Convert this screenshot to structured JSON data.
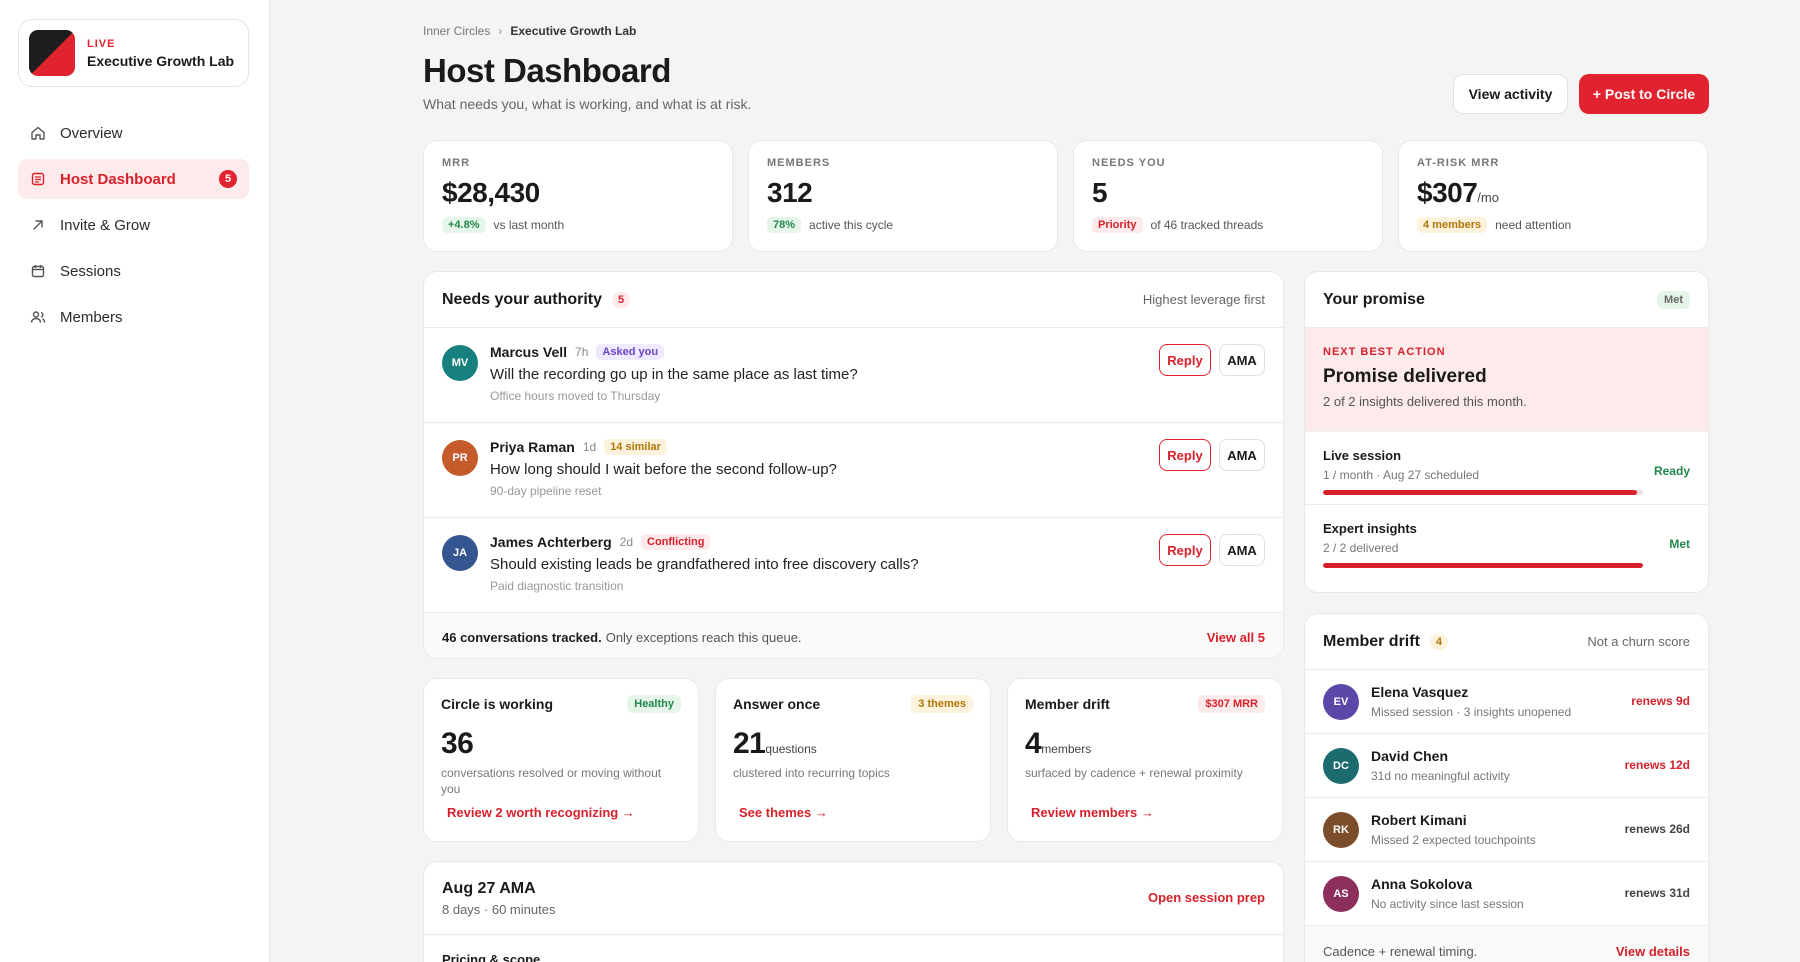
{
  "brand": {
    "status": "LIVE",
    "name": "Executive Growth Lab"
  },
  "nav": {
    "items": [
      {
        "label": "Overview",
        "icon": "home-icon"
      },
      {
        "label": "Host Dashboard",
        "icon": "dashboard-icon",
        "badge": "5"
      },
      {
        "label": "Invite & Grow",
        "icon": "arrow-up-right-icon"
      },
      {
        "label": "Sessions",
        "icon": "calendar-icon"
      },
      {
        "label": "Members",
        "icon": "users-icon"
      }
    ]
  },
  "breadcrumb": {
    "parent": "Inner Circles",
    "separator": "›",
    "current": "Executive Growth Lab"
  },
  "header": {
    "title": "Host Dashboard",
    "subtitle": "What needs you, what is working, and what is at risk.",
    "view_activity": "View activity",
    "post": "+ Post to Circle"
  },
  "kpis": [
    {
      "label": "MRR",
      "value": "$28,430",
      "unit": "",
      "pill": "+4.8%",
      "note": "vs last month"
    },
    {
      "label": "MEMBERS",
      "value": "312",
      "unit": "",
      "pill": "78%",
      "note": "active this cycle"
    },
    {
      "label": "NEEDS YOU",
      "value": "5",
      "unit": "",
      "pill": "Priority",
      "note": "of 46 tracked threads"
    },
    {
      "label": "AT-RISK MRR",
      "value": "$307",
      "unit": "/mo",
      "pill": "4 members",
      "note": "need attention"
    }
  ],
  "authority": {
    "title": "Needs your authority",
    "count": "5",
    "sort": "Highest leverage first",
    "reply_label": "Reply",
    "ama_label": "AMA",
    "threads": [
      {
        "initials": "MV",
        "name": "Marcus Vell",
        "time": "7h",
        "tag": "Asked you",
        "question": "Will the recording go up in the same place as last time?",
        "note": "Office hours moved to Thursday"
      },
      {
        "initials": "PR",
        "name": "Priya Raman",
        "time": "1d",
        "tag": "14 similar",
        "question": "How long should I wait before the second follow-up?",
        "note": "90-day pipeline reset"
      },
      {
        "initials": "JA",
        "name": "James Achterberg",
        "time": "2d",
        "tag": "Conflicting",
        "question": "Should existing leads be grandfathered into free discovery calls?",
        "note": "Paid diagnostic transition"
      }
    ],
    "footer_bold": "46 conversations tracked.",
    "footer_text": "Only exceptions reach this queue.",
    "footer_link": "View all 5"
  },
  "mini_cards": [
    {
      "title": "Circle is working",
      "tag": "Healthy",
      "value": "36",
      "unit": "",
      "desc": "conversations resolved or moving without you",
      "link": "Review 2 worth recognizing →"
    },
    {
      "title": "Answer once",
      "tag": "3 themes",
      "value": "21",
      "unit": "questions",
      "desc": "clustered into recurring topics",
      "link": "See themes →"
    },
    {
      "title": "Member drift",
      "tag": "$307 MRR",
      "value": "4",
      "unit": "members",
      "desc": "surfaced by cadence + renewal proximity",
      "link": "Review members →"
    }
  ],
  "ama": {
    "title": "Aug 27 AMA",
    "sub": "8 days · 60 minutes",
    "link": "Open session prep",
    "first_item": "Pricing & scope"
  },
  "promise": {
    "title": "Your promise",
    "status": "Met",
    "nba_label": "NEXT BEST ACTION",
    "nba_title": "Promise delivered",
    "nba_sub": "2 of 2 insights delivered this month.",
    "items": [
      {
        "title": "Live session",
        "sub": "1 / month · Aug 27 scheduled",
        "status": "Ready",
        "progress": 0.98
      },
      {
        "title": "Expert insights",
        "sub": "2 / 2 delivered",
        "status": "Met",
        "progress": 1.0
      }
    ]
  },
  "drift": {
    "title": "Member drift",
    "count": "4",
    "note": "Not a churn score",
    "members": [
      {
        "initials": "EV",
        "name": "Elena Vasquez",
        "note": "Missed session · 3 insights unopened",
        "renew": "renews 9d"
      },
      {
        "initials": "DC",
        "name": "David Chen",
        "note": "31d no meaningful activity",
        "renew": "renews 12d"
      },
      {
        "initials": "RK",
        "name": "Robert Kimani",
        "note": "Missed 2 expected touchpoints",
        "renew": "renews 26d"
      },
      {
        "initials": "AS",
        "name": "Anna Sokolova",
        "note": "No activity since last session",
        "renew": "renews 31d"
      }
    ],
    "footer_text": "Cadence + renewal timing.",
    "footer_link": "View details"
  },
  "colors": {
    "accent": "#e0232f",
    "avatar_mv": "#17807e",
    "avatar_pr": "#c55a2b",
    "avatar_ja": "#34558f",
    "avatar_ev": "#5b47a8",
    "avatar_dc": "#1c6b6e",
    "avatar_rk": "#7c4d2a",
    "avatar_as": "#8d2f5d"
  }
}
